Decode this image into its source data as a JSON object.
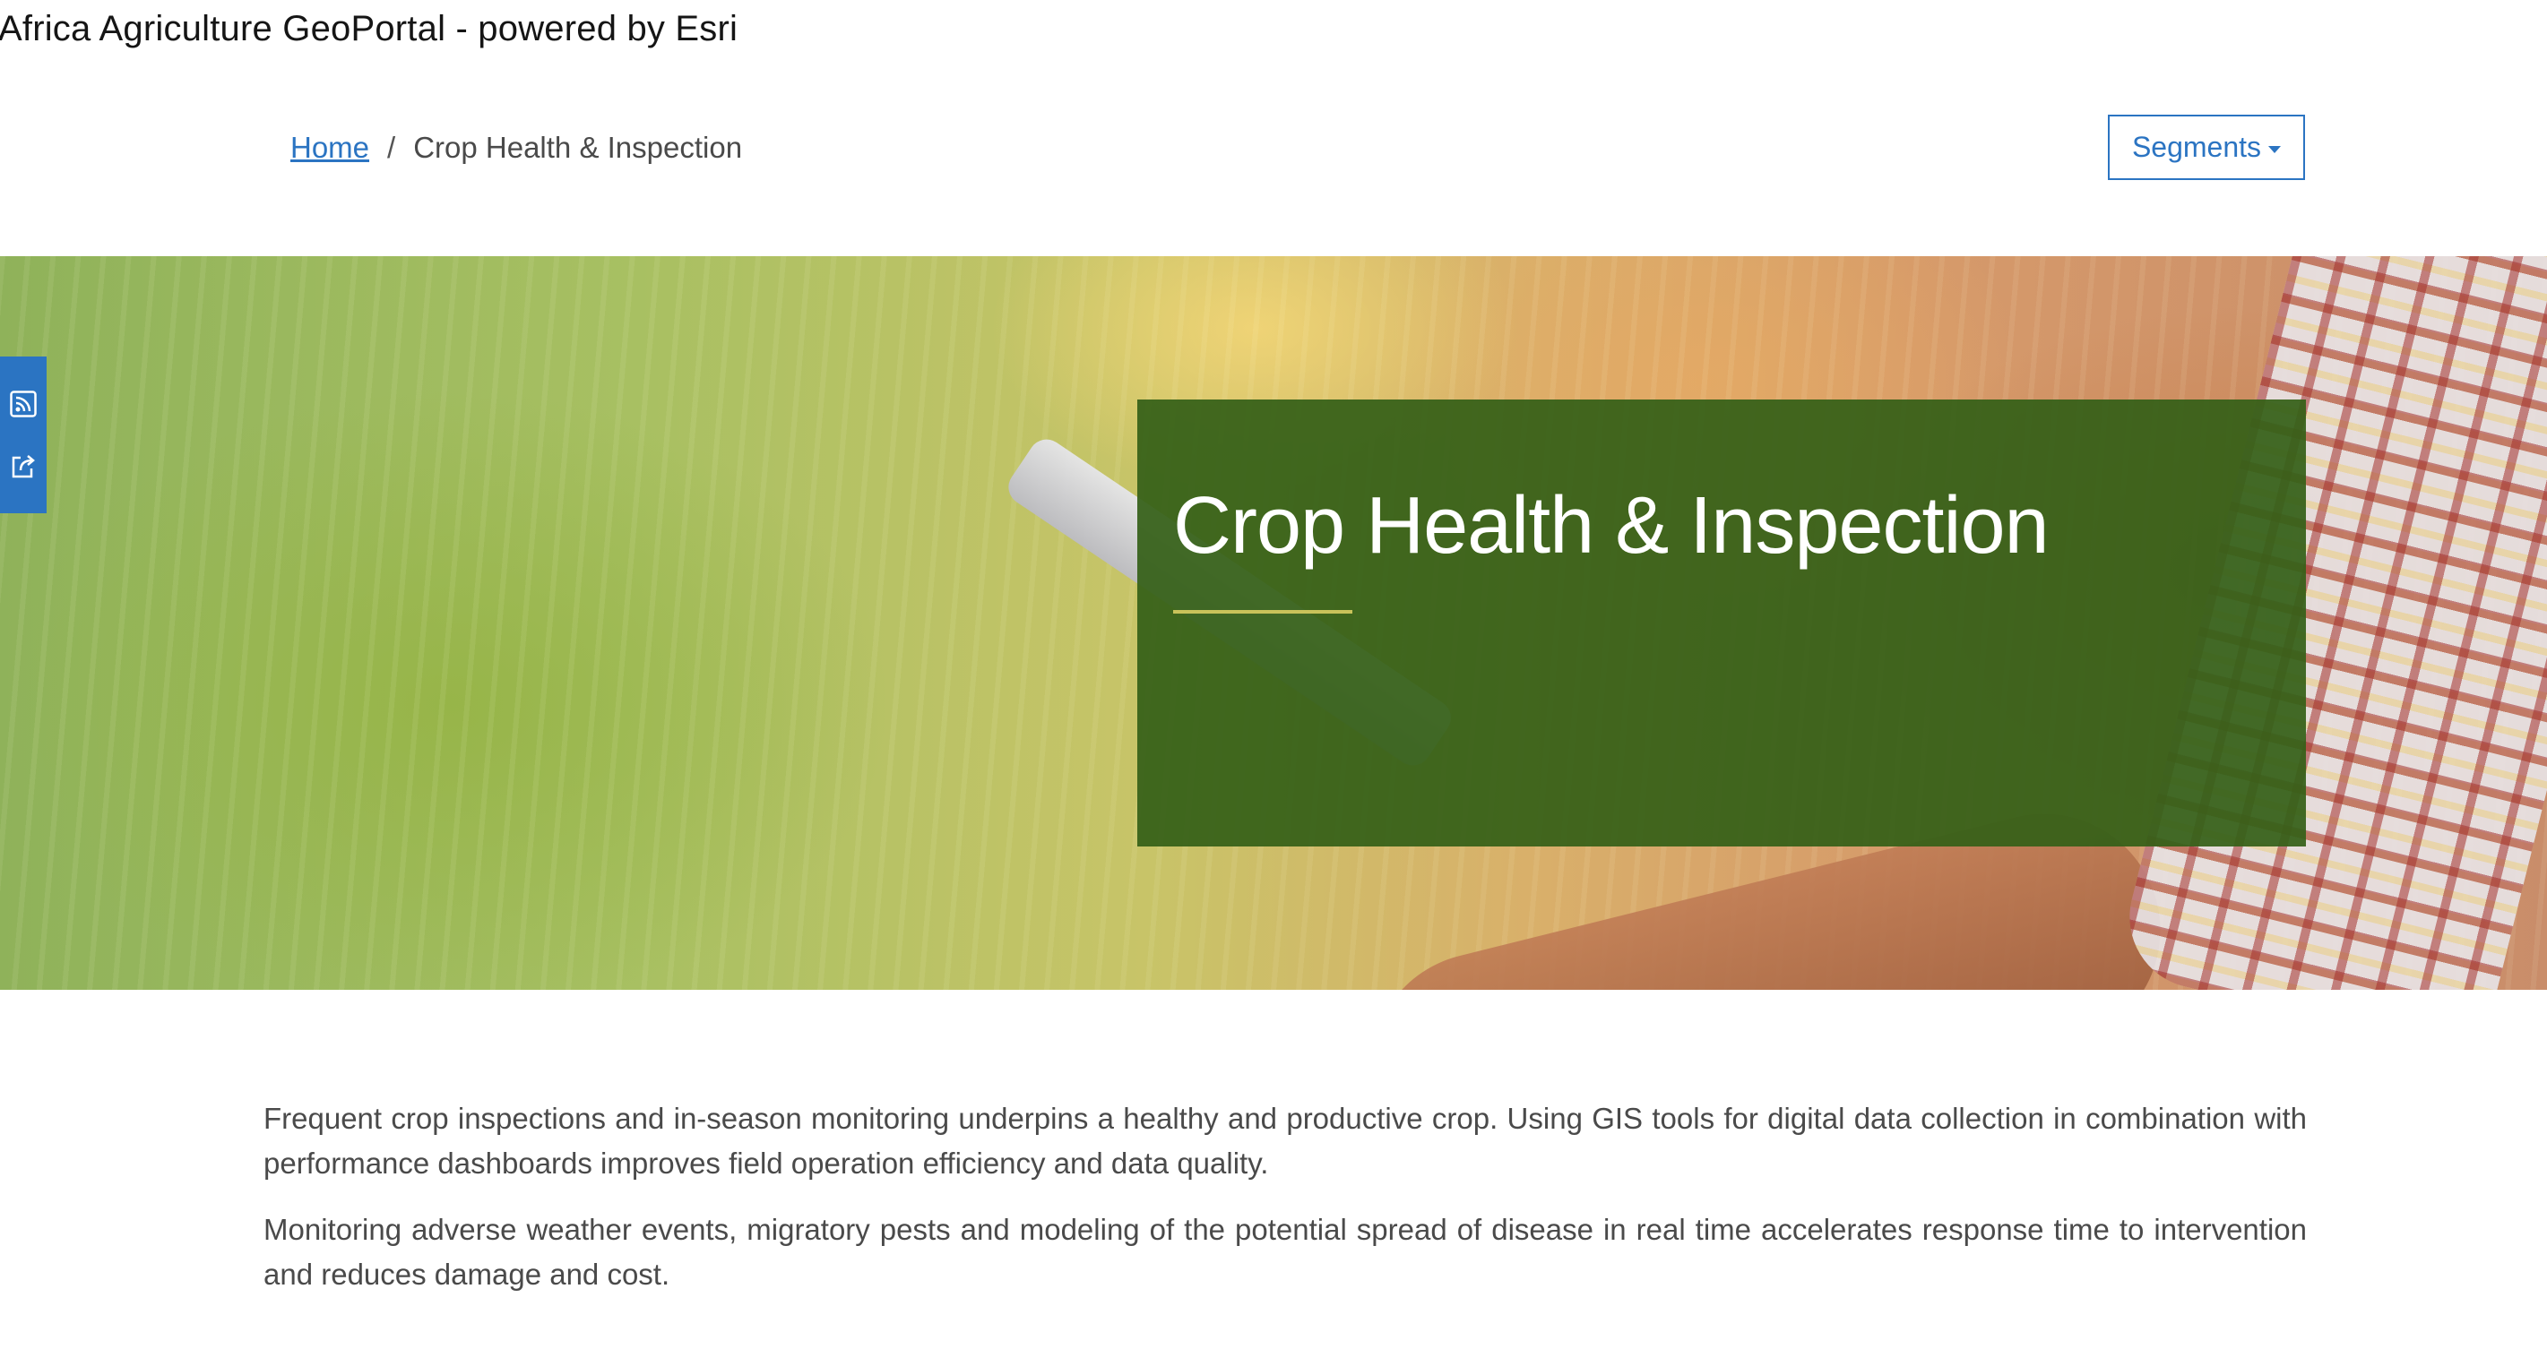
{
  "site": {
    "title": "Africa Agriculture GeoPortal - powered by Esri"
  },
  "breadcrumb": {
    "home_label": "Home",
    "separator": "/",
    "current_label": "Crop Health & Inspection"
  },
  "nav": {
    "segments_label": "Segments"
  },
  "side_share": {
    "icons": [
      "rss-icon",
      "share-icon"
    ],
    "background_color": "#2b74c2"
  },
  "hero": {
    "title": "Crop Health & Inspection",
    "card_color": "#356018",
    "rule_color": "#c9c25a"
  },
  "content": {
    "paragraphs": [
      "Frequent crop inspections and in-season monitoring underpins a healthy and productive crop. Using GIS tools for digital data collection in combination with performance dashboards improves field operation efficiency and data quality.",
      "Monitoring adverse weather events, migratory pests and modeling of the potential spread of disease in real time accelerates response time to intervention and reduces damage and cost."
    ]
  },
  "colors": {
    "link": "#2b74c2",
    "body_text": "#4a4a4a"
  }
}
